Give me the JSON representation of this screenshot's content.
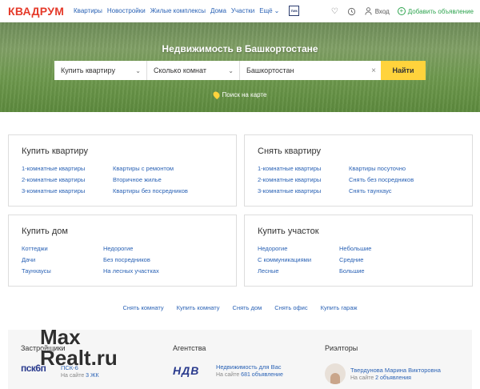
{
  "header": {
    "logo": "КВАДРУМ",
    "nav": [
      "Квартиры",
      "Новостройки",
      "Жилые комплексы",
      "Дома",
      "Участки",
      "Ещё"
    ],
    "pik_label": "ПИК",
    "login": "Вход",
    "add_ad": "Добавить объявление"
  },
  "hero": {
    "title": "Недвижимость в Башкортостане",
    "deal_select": "Купить квартиру",
    "rooms_select": "Сколько комнат",
    "location_value": "Башкортостан",
    "find_button": "Найти",
    "map_link": "Поиск на карте"
  },
  "cards": {
    "buy_flat": {
      "title": "Купить квартиру",
      "col1": [
        "1-комнатные квартиры",
        "2-комнатные квартиры",
        "3-комнатные квартиры"
      ],
      "col2": [
        "Квартиры с ремонтом",
        "Вторичное жилье",
        "Квартиры без посредников"
      ]
    },
    "rent_flat": {
      "title": "Снять квартиру",
      "col1": [
        "1-комнатные квартиры",
        "2-комнатные квартиры",
        "3-комнатные квартиры"
      ],
      "col2": [
        "Квартиры посуточно",
        "Снять без посредников",
        "Снять таунхаус"
      ]
    },
    "buy_house": {
      "title": "Купить дом",
      "col1": [
        "Коттеджи",
        "Дачи",
        "Таунхаусы"
      ],
      "col2": [
        "Недорогие",
        "Без посредников",
        "На лесных участках"
      ]
    },
    "buy_plot": {
      "title": "Купить участок",
      "col1": [
        "Недорогие",
        "С коммуникациями",
        "Лесные"
      ],
      "col2": [
        "Небольшие",
        "Средние",
        "Большие"
      ]
    }
  },
  "bottom_links": [
    "Снять комнату",
    "Купить комнату",
    "Снять дом",
    "Снять офис",
    "Купить гараж"
  ],
  "footer": {
    "developers": {
      "title": "Застройщики",
      "name": "ПСК-6",
      "sub_prefix": "На сайте",
      "sub_link": "3 ЖК",
      "logo": "пск6п"
    },
    "agencies": {
      "title": "Агентства",
      "name": "Недвижимость для Вас",
      "sub_prefix": "На сайте",
      "sub_link": "681 объявление",
      "logo": "НДВ"
    },
    "realtors": {
      "title": "Риэлторы",
      "name": "Твердунова Марина Викторовна",
      "sub_prefix": "На сайте",
      "sub_link": "2 объявления"
    }
  },
  "watermark": "Max\nRealt.ru",
  "colors": {
    "brand": "#e53a2a",
    "link": "#2a62b5",
    "button": "#ffd33c",
    "add": "#2ea44f"
  }
}
